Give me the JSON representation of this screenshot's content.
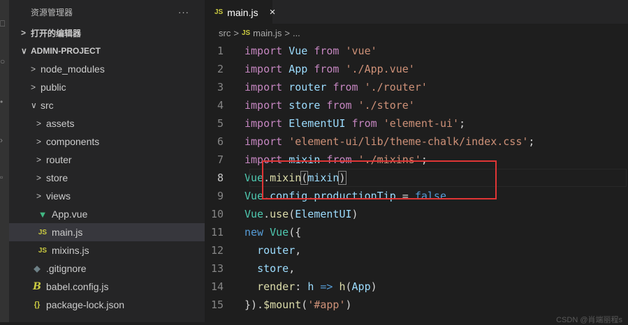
{
  "sidebar": {
    "title": "资源管理器",
    "more": "···",
    "open_editors": "打开的编辑器",
    "project": "ADMIN-PROJECT",
    "tree": [
      {
        "chev": ">",
        "label": "node_modules",
        "indent": 1,
        "icon": ""
      },
      {
        "chev": ">",
        "label": "public",
        "indent": 1,
        "icon": ""
      },
      {
        "chev": "∨",
        "label": "src",
        "indent": 1,
        "icon": ""
      },
      {
        "chev": ">",
        "label": "assets",
        "indent": 2,
        "icon": ""
      },
      {
        "chev": ">",
        "label": "components",
        "indent": 2,
        "icon": ""
      },
      {
        "chev": ">",
        "label": "router",
        "indent": 2,
        "icon": ""
      },
      {
        "chev": ">",
        "label": "store",
        "indent": 2,
        "icon": ""
      },
      {
        "chev": ">",
        "label": "views",
        "indent": 2,
        "icon": ""
      },
      {
        "chev": "",
        "label": "App.vue",
        "indent": 2,
        "icon": "vue"
      },
      {
        "chev": "",
        "label": "main.js",
        "indent": 2,
        "icon": "js",
        "selected": true
      },
      {
        "chev": "",
        "label": "mixins.js",
        "indent": 2,
        "icon": "js"
      },
      {
        "chev": "",
        "label": ".gitignore",
        "indent": 1,
        "icon": "git"
      },
      {
        "chev": "",
        "label": "babel.config.js",
        "indent": 1,
        "icon": "babel"
      },
      {
        "chev": "",
        "label": "package-lock.json",
        "indent": 1,
        "icon": "json"
      }
    ],
    "icon_text": {
      "js": "JS",
      "vue": "▼",
      "git": "◆",
      "babel": "B",
      "json": "{}"
    }
  },
  "tab": {
    "icon": "JS",
    "label": "main.js",
    "close": "×"
  },
  "breadcrumb": {
    "folder": "src",
    "sep": ">",
    "icon": "JS",
    "file": "main.js",
    "tail": "..."
  },
  "code": {
    "active_line": 8,
    "lines": [
      [
        [
          "kw",
          "import "
        ],
        [
          "var",
          "Vue "
        ],
        [
          "kw",
          "from "
        ],
        [
          "str",
          "'vue'"
        ]
      ],
      [
        [
          "kw",
          "import "
        ],
        [
          "var",
          "App "
        ],
        [
          "kw",
          "from "
        ],
        [
          "str",
          "'./App.vue'"
        ]
      ],
      [
        [
          "kw",
          "import "
        ],
        [
          "var",
          "router "
        ],
        [
          "kw",
          "from "
        ],
        [
          "str",
          "'./router'"
        ]
      ],
      [
        [
          "kw",
          "import "
        ],
        [
          "var",
          "store "
        ],
        [
          "kw",
          "from "
        ],
        [
          "str",
          "'./store'"
        ]
      ],
      [
        [
          "kw",
          "import "
        ],
        [
          "var",
          "ElementUI "
        ],
        [
          "kw",
          "from "
        ],
        [
          "str",
          "'element-ui'"
        ],
        [
          "pl",
          ";"
        ]
      ],
      [
        [
          "kw",
          "import "
        ],
        [
          "str",
          "'element-ui/lib/theme-chalk/index.css'"
        ],
        [
          "pl",
          ";"
        ]
      ],
      [
        [
          "kw",
          "import "
        ],
        [
          "var",
          "mixin "
        ],
        [
          "kw",
          "from "
        ],
        [
          "str",
          "'./mixins'"
        ],
        [
          "pl",
          ";"
        ]
      ],
      [
        [
          "cls",
          "Vue"
        ],
        [
          "pl",
          "."
        ],
        [
          "fn",
          "mixin"
        ],
        [
          "br",
          "("
        ],
        [
          "var",
          "mixin"
        ],
        [
          "br",
          ")"
        ]
      ],
      [
        [
          "cls",
          "Vue"
        ],
        [
          "pl",
          "."
        ],
        [
          "var",
          "config"
        ],
        [
          "pl",
          "."
        ],
        [
          "var",
          "productionTip"
        ],
        [
          "pl",
          " = "
        ],
        [
          "bool",
          "false"
        ]
      ],
      [
        [
          "cls",
          "Vue"
        ],
        [
          "pl",
          "."
        ],
        [
          "fn",
          "use"
        ],
        [
          "pl",
          "("
        ],
        [
          "var",
          "ElementUI"
        ],
        [
          "pl",
          ")"
        ]
      ],
      [
        [
          "bool",
          "new "
        ],
        [
          "cls",
          "Vue"
        ],
        [
          "pl",
          "({"
        ]
      ],
      [
        [
          "pl",
          "  "
        ],
        [
          "var",
          "router"
        ],
        [
          "pl",
          ","
        ]
      ],
      [
        [
          "pl",
          "  "
        ],
        [
          "var",
          "store"
        ],
        [
          "pl",
          ","
        ]
      ],
      [
        [
          "pl",
          "  "
        ],
        [
          "fn",
          "render"
        ],
        [
          "pl",
          ": "
        ],
        [
          "var",
          "h"
        ],
        [
          "pl",
          " "
        ],
        [
          "bool",
          "=>"
        ],
        [
          "pl",
          " "
        ],
        [
          "fn",
          "h"
        ],
        [
          "pl",
          "("
        ],
        [
          "var",
          "App"
        ],
        [
          "pl",
          ")"
        ]
      ],
      [
        [
          "pl",
          "})."
        ],
        [
          "fn",
          "$mount"
        ],
        [
          "pl",
          "("
        ],
        [
          "str",
          "'#app'"
        ],
        [
          "pl",
          ")"
        ]
      ]
    ]
  },
  "watermark": "CSDN @肖端丽程s"
}
